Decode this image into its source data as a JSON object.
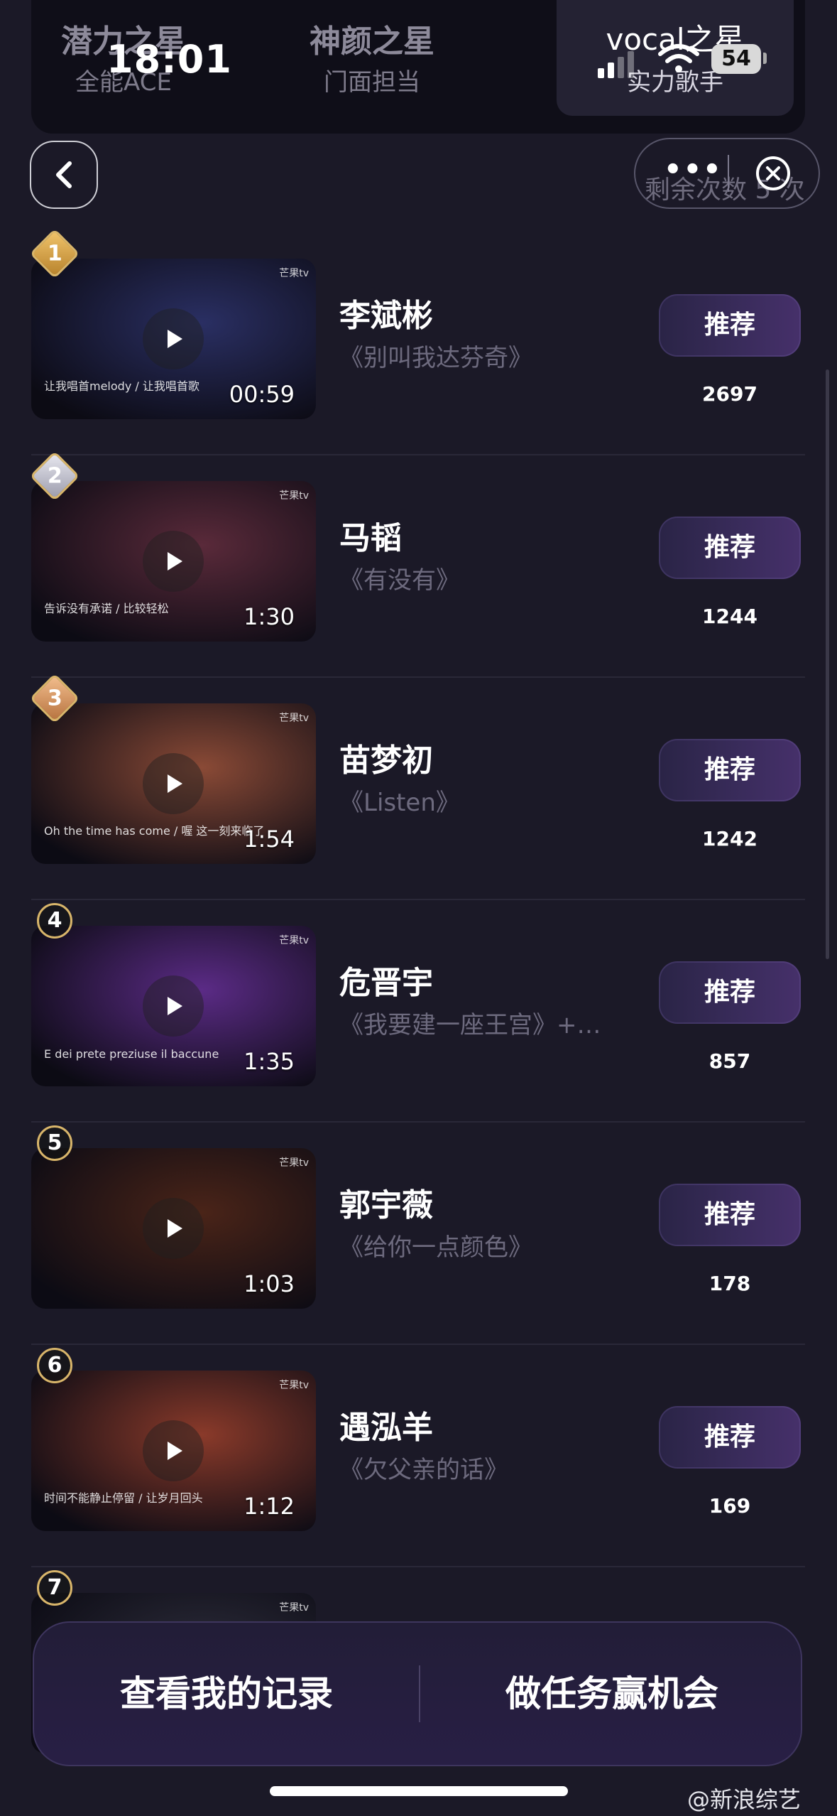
{
  "status": {
    "time": "18:01",
    "battery": "54"
  },
  "tabs": [
    {
      "title": "潜力之星",
      "subtitle": "全能ACE",
      "active": false
    },
    {
      "title": "神颜之星",
      "subtitle": "门面担当",
      "active": false
    },
    {
      "title": "vocal之星",
      "subtitle": "实力歌手",
      "active": true
    }
  ],
  "header": {
    "remaining": "剩余次数 5 次"
  },
  "items": [
    {
      "rank": "1",
      "name": "李斌彬",
      "song": "《别叫我达芬奇》",
      "duration": "00:59",
      "button": "推荐",
      "count": "2697",
      "subtitle_text": "让我唱首melody / 让我唱首歌",
      "thumb_color": "#2a2f63"
    },
    {
      "rank": "2",
      "name": "马韬",
      "song": "《有没有》",
      "duration": "1:30",
      "button": "推荐",
      "count": "1244",
      "subtitle_text": "告诉没有承诺 / 比较轻松",
      "thumb_color": "#5a2a3a"
    },
    {
      "rank": "3",
      "name": "苗梦初",
      "song": "《Listen》",
      "duration": "1:54",
      "button": "推荐",
      "count": "1242",
      "subtitle_text": "Oh the time has come / 喔 这一刻来临了",
      "thumb_color": "#8a4a36"
    },
    {
      "rank": "4",
      "name": "危晋宇",
      "song": "《我要建一座王宫》+…",
      "duration": "1:35",
      "button": "推荐",
      "count": "857",
      "subtitle_text": "E dei prete preziuse il baccune",
      "thumb_color": "#5b2b86"
    },
    {
      "rank": "5",
      "name": "郭宇薇",
      "song": "《给你一点颜色》",
      "duration": "1:03",
      "button": "推荐",
      "count": "178",
      "subtitle_text": "",
      "thumb_color": "#4a2418"
    },
    {
      "rank": "6",
      "name": "遇泓羊",
      "song": "《欠父亲的话》",
      "duration": "1:12",
      "button": "推荐",
      "count": "169",
      "subtitle_text": "时间不能静止停留 / 让岁月回头",
      "thumb_color": "#8a3a2a"
    },
    {
      "rank": "7",
      "name": "",
      "song": "",
      "duration": "",
      "button": "",
      "count": "",
      "subtitle_text": "",
      "thumb_color": "#2c2c3a"
    }
  ],
  "bottom": {
    "left": "查看我的记录",
    "right": "做任务赢机会"
  },
  "watermark": "@新浪综艺",
  "thumb_logo": "芒果tv"
}
